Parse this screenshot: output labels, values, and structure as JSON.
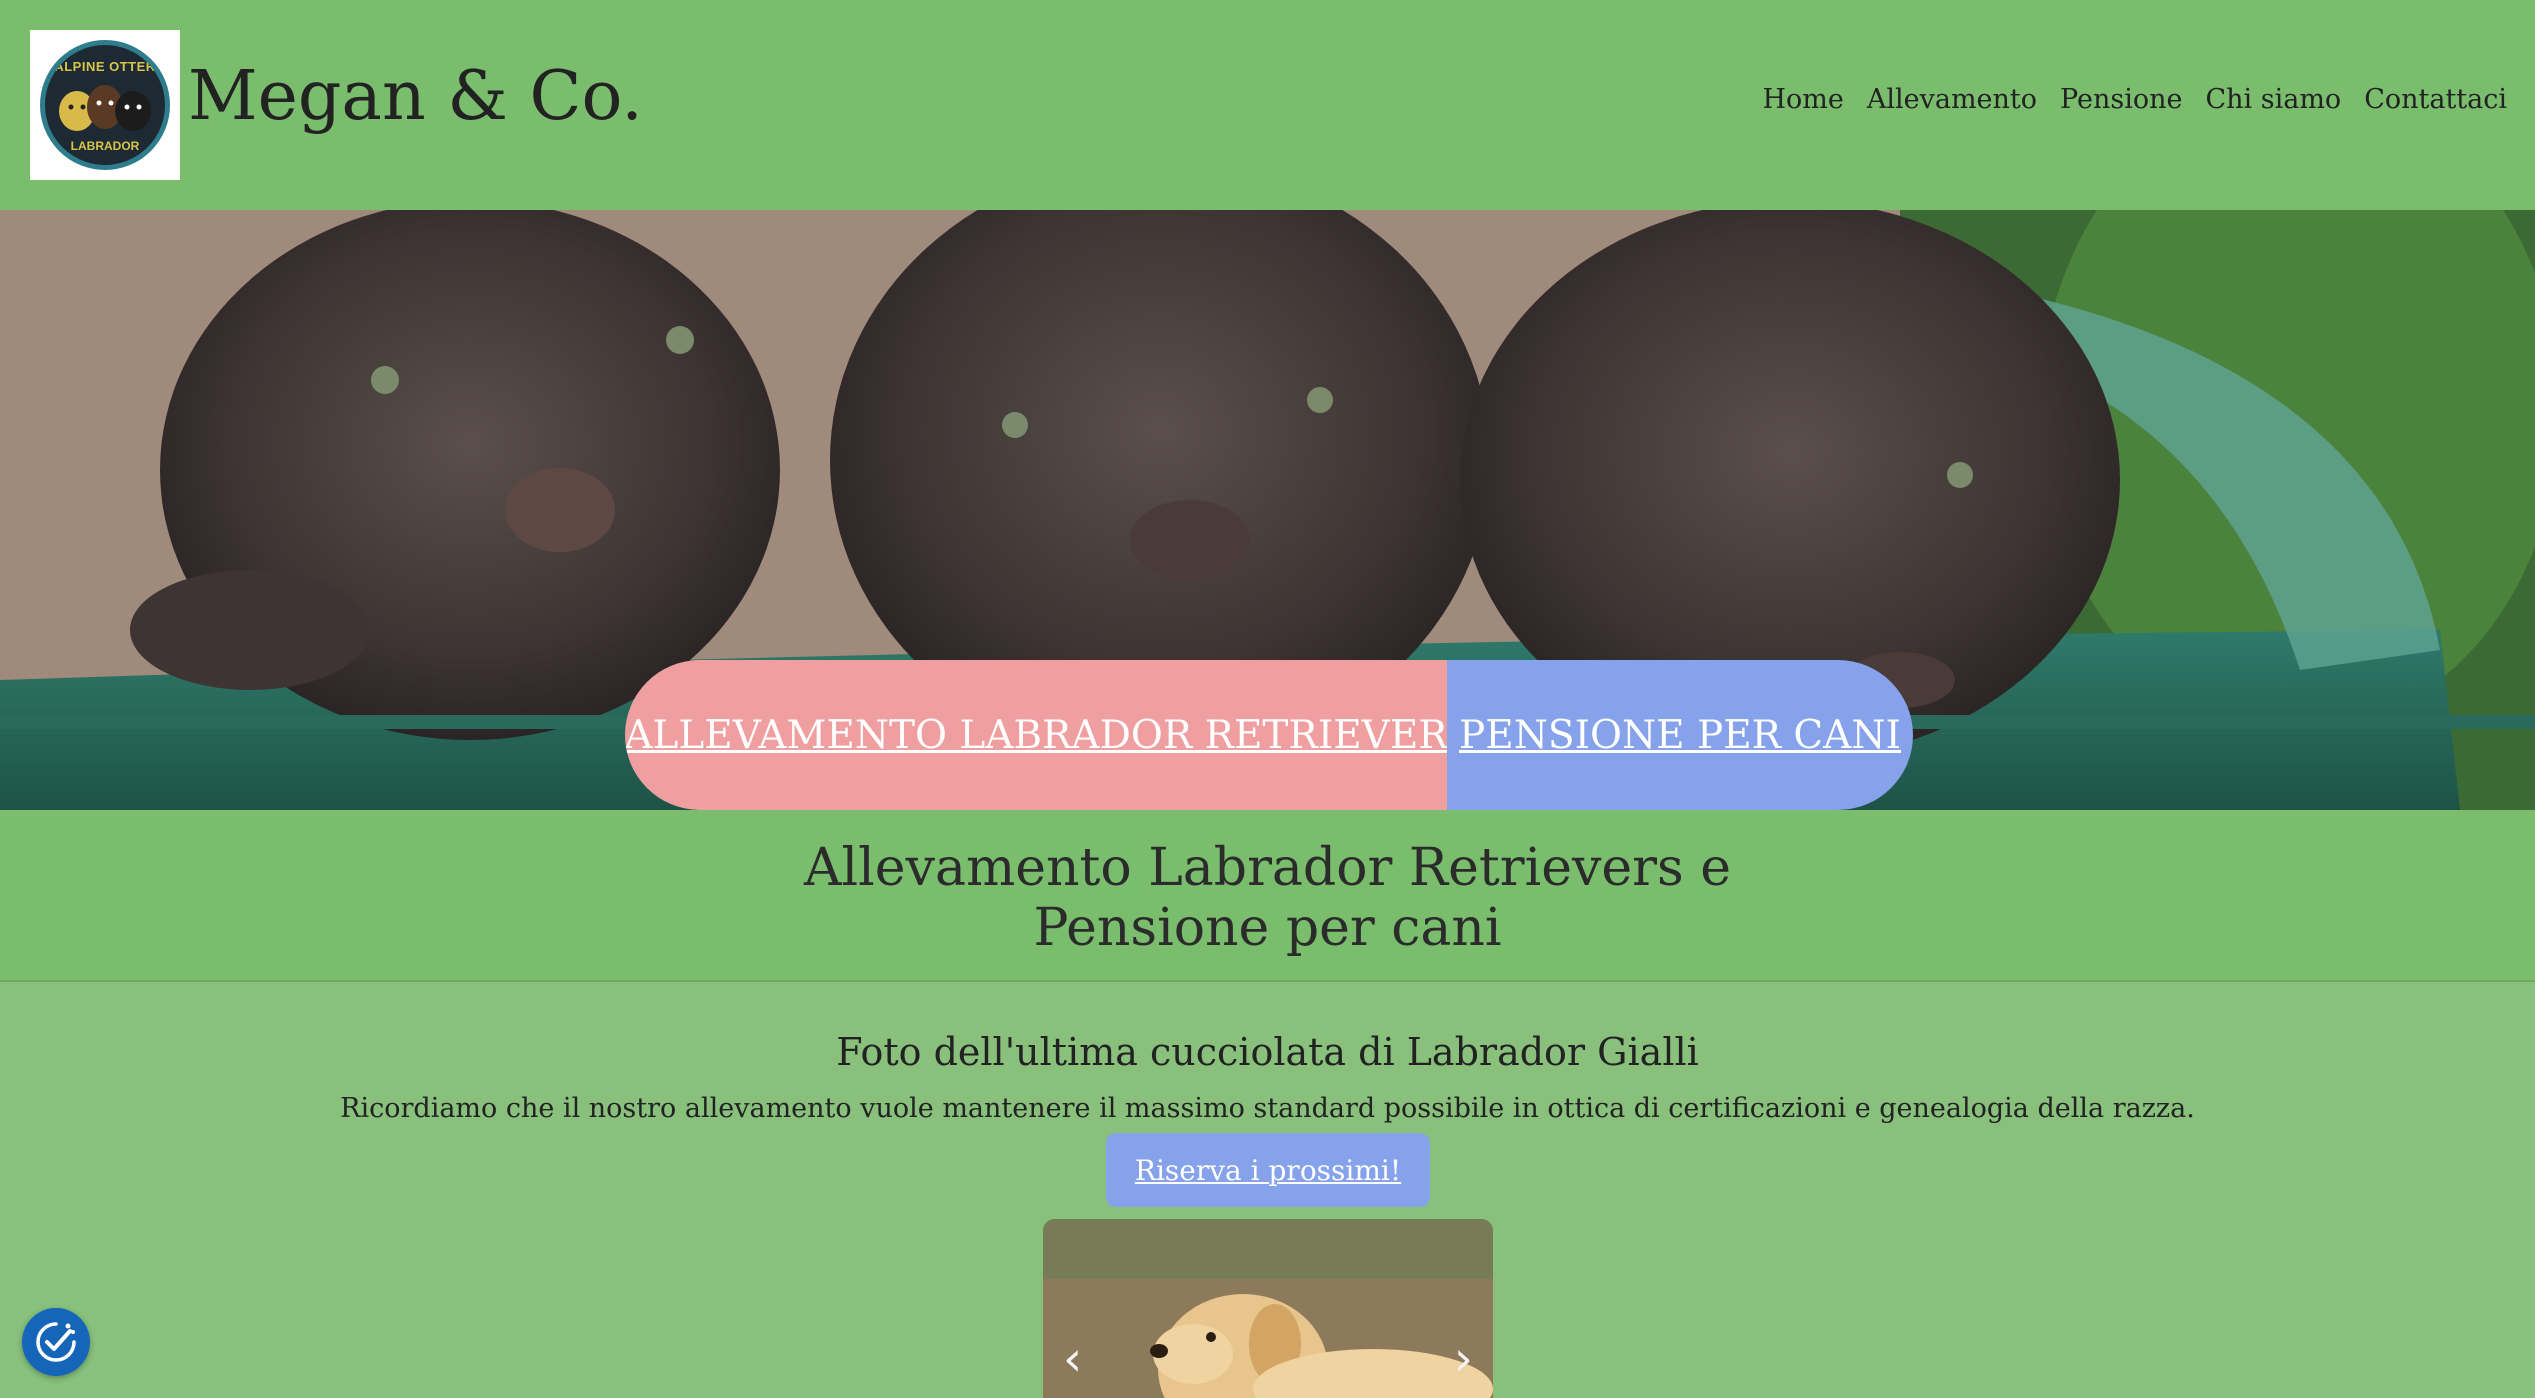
{
  "header": {
    "logo": {
      "text_top": "ALPINE OTTER",
      "text_bottom": "LABRADOR"
    },
    "site_title": "Megan & Co.",
    "nav": [
      "Home",
      "Allevamento",
      "Pensione",
      "Chi siamo",
      "Contattaci"
    ]
  },
  "hero": {
    "cta_breeding": "ALLEVAMENTO LABRADOR RETRIEVER",
    "cta_boarding": "PENSIONE PER CANI"
  },
  "intro": {
    "title_line1": "Allevamento Labrador Retrievers e",
    "title_line2": "Pensione per cani"
  },
  "litter": {
    "title": "Foto dell'ultima cucciolata di Labrador Gialli",
    "description": "Ricordiamo che il nostro allevamento vuole mantenere il massimo standard possibile in ottica di certificazioni e genealogia della razza.",
    "reserve_button": "Riserva i prossimi!",
    "prev_arrow": "‹",
    "next_arrow": "›"
  },
  "colors": {
    "header_bg": "#79bd6d",
    "page_bg": "#88c07c",
    "cta_pink": "#ef9fa0",
    "cta_blue": "#85a2ea",
    "accessibility_blue": "#1565b8"
  },
  "icons": {
    "accessibility": "accessibility-check-icon",
    "carousel_prev": "chevron-left-icon",
    "carousel_next": "chevron-right-icon"
  }
}
